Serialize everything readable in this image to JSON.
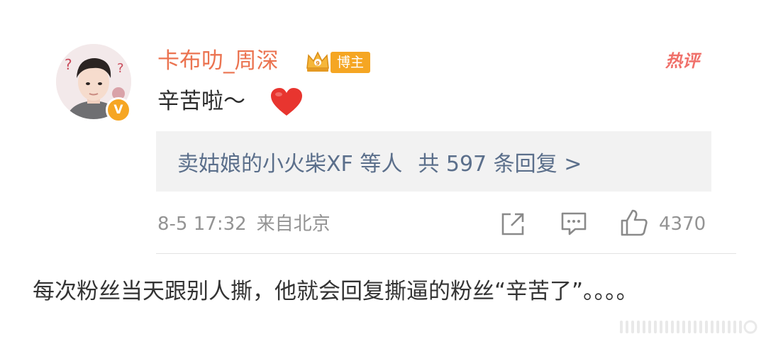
{
  "comment": {
    "username": "卡布叻_周深",
    "blogger_badge": "博主",
    "hot_label": "热评",
    "text": "辛苦啦～",
    "reply_summary": {
      "users": "卖姑娘的小火柴XF 等人",
      "count_text": "共 597 条回复 >"
    },
    "timestamp": "8-5 17:32",
    "location": "来自北京",
    "like_count": "4370",
    "verified_badge": "V"
  },
  "caption": "每次粉丝当天跟别人撕，他就会回复撕逼的粉丝“辛苦了”。。。。",
  "icons": {
    "avatar": "avatar-photo",
    "verified": "verified-v-icon",
    "crown": "crown-icon",
    "heart": "heart-icon",
    "share": "share-icon",
    "comment": "comment-icon",
    "like": "thumbs-up-icon"
  },
  "colors": {
    "username": "#eb7350",
    "badge": "#f5a623",
    "hot_label": "#f0706a",
    "reply_text": "#5b6f8b",
    "reply_bg": "#f2f2f2",
    "meta_text": "#939393",
    "heart": "#e8352f"
  }
}
